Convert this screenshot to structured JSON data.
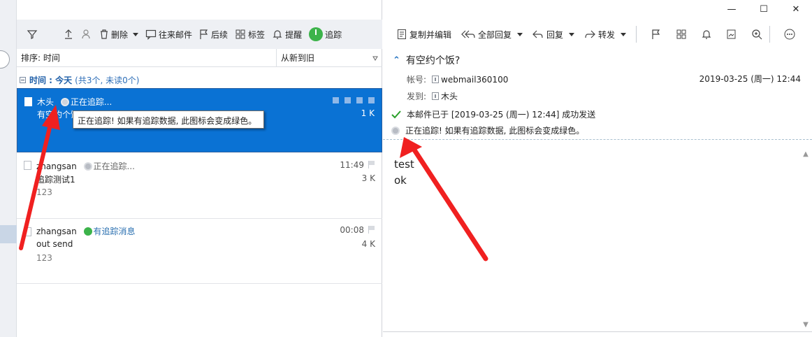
{
  "window": {
    "minimize": "—",
    "maximize": "☐",
    "close": "✕"
  },
  "toolbar_left": {
    "delete": "删除",
    "correspondence": "往来邮件",
    "followup": "后续",
    "tags": "标签",
    "remind": "提醒",
    "track": "追踪"
  },
  "sort": {
    "label": "排序: 时间",
    "order": "从新到旧"
  },
  "group": {
    "title": "时间 : 今天",
    "count": "(共3个, 未读0个)"
  },
  "mails": [
    {
      "sender": "木头",
      "status": "正在追踪...",
      "subject": "有空约个饭?",
      "size": "1 K",
      "time": "",
      "preview": ""
    },
    {
      "sender": "zhangsan",
      "status": "正在追踪...",
      "subject": "追踪测试1",
      "size": "3 K",
      "time": "11:49",
      "preview": "123"
    },
    {
      "sender": "zhangsan",
      "status": "有追踪消息",
      "subject": "out send",
      "size": "4 K",
      "time": "00:08",
      "preview": "123"
    }
  ],
  "tooltip": "正在追踪! 如果有追踪数据, 此图标会变成绿色。",
  "toolbar_right": {
    "copy_edit": "复制并编辑",
    "reply_all": "全部回复",
    "reply": "回复",
    "forward": "转发"
  },
  "reading": {
    "subject": "有空约个饭?",
    "account_label": "帐号:",
    "account": "webmail360100",
    "to_label": "发到:",
    "to": "木头",
    "date": "2019-03-25 (周一) 12:44",
    "sent_status": "本邮件已于 [2019-03-25 (周一) 12:44] 成功发送",
    "track_status": "正在追踪! 如果有追踪数据, 此图标会变成绿色。",
    "body_lines": [
      "test",
      "ok"
    ]
  },
  "colors": {
    "selected_bg": "#0a72d4",
    "track_green": "#3cb34a",
    "arrow_red": "#f02020",
    "link_blue": "#1f5fa8"
  }
}
